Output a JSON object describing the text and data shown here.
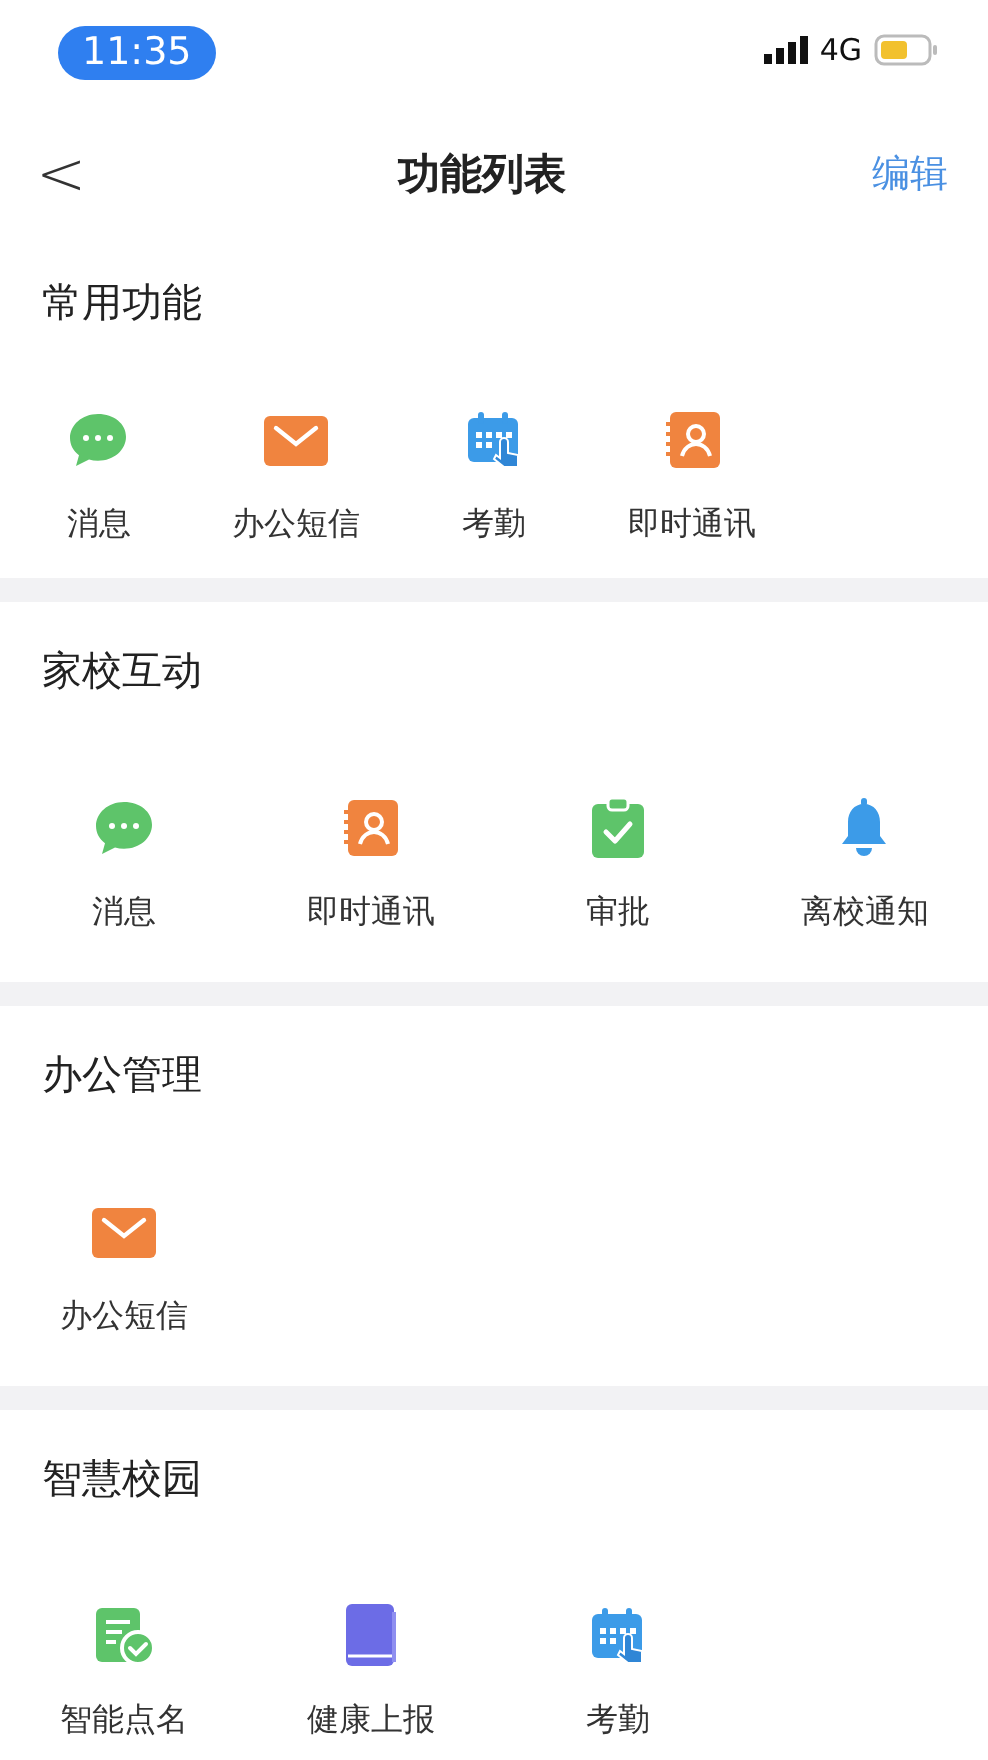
{
  "status_bar": {
    "time": "11:35",
    "network": "4G"
  },
  "nav": {
    "back": "<",
    "title": "功能列表",
    "action": "编辑"
  },
  "sections": [
    {
      "title": "常用功能",
      "items": [
        {
          "label": "消息",
          "kind": "message"
        },
        {
          "label": "办公短信",
          "kind": "mail"
        },
        {
          "label": "考勤",
          "kind": "attendance"
        },
        {
          "label": "即时通讯",
          "kind": "contacts"
        }
      ]
    },
    {
      "title": "家校互动",
      "items": [
        {
          "label": "消息",
          "kind": "message"
        },
        {
          "label": "即时通讯",
          "kind": "contacts"
        },
        {
          "label": "审批",
          "kind": "approve"
        },
        {
          "label": "离校通知",
          "kind": "bell"
        }
      ]
    },
    {
      "title": "办公管理",
      "items": [
        {
          "label": "办公短信",
          "kind": "mail"
        }
      ]
    },
    {
      "title": "智慧校园",
      "items": [
        {
          "label": "智能点名",
          "kind": "rollcall"
        },
        {
          "label": "健康上报",
          "kind": "health"
        },
        {
          "label": "考勤",
          "kind": "attendance"
        }
      ]
    }
  ]
}
